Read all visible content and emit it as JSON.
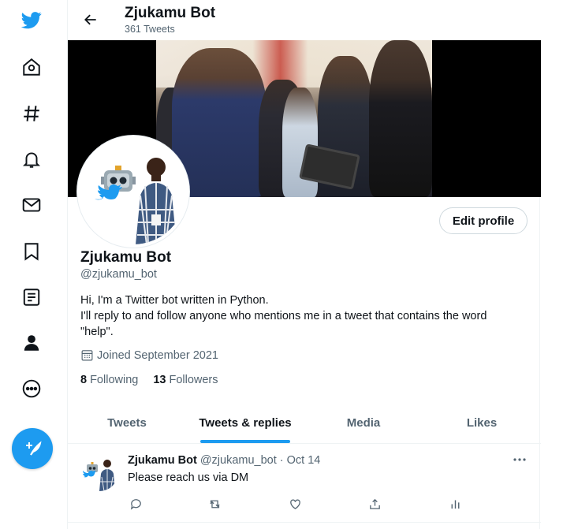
{
  "nav": {
    "brand_color": "#1d9bf0",
    "items": [
      {
        "icon": "twitter-bird-icon"
      },
      {
        "icon": "home-icon"
      },
      {
        "icon": "explore-hashtag-icon"
      },
      {
        "icon": "notifications-bell-icon"
      },
      {
        "icon": "messages-mail-icon"
      },
      {
        "icon": "bookmark-icon"
      },
      {
        "icon": "lists-icon"
      },
      {
        "icon": "profile-icon"
      },
      {
        "icon": "more-icon"
      },
      {
        "icon": "compose-tweet-icon"
      }
    ]
  },
  "header": {
    "title": "Zjukamu Bot",
    "subtitle": "361 Tweets"
  },
  "profile": {
    "edit_label": "Edit profile",
    "name": "Zjukamu Bot",
    "handle": "@zjukamu_bot",
    "bio_line1": "Hi, I'm a Twitter bot written in Python.",
    "bio_line2": "I'll reply to and follow anyone who mentions me in a tweet that contains the word \"help\".",
    "joined": "Joined September 2021",
    "following_count": "8",
    "following_label": "Following",
    "followers_count": "13",
    "followers_label": "Followers"
  },
  "tabs": [
    {
      "label": "Tweets",
      "active": false
    },
    {
      "label": "Tweets & replies",
      "active": true
    },
    {
      "label": "Media",
      "active": false
    },
    {
      "label": "Likes",
      "active": false
    }
  ],
  "tweet": {
    "name": "Zjukamu Bot",
    "meta": "@zjukamu_bot · Oct 14",
    "text": "Please reach us via DM"
  }
}
